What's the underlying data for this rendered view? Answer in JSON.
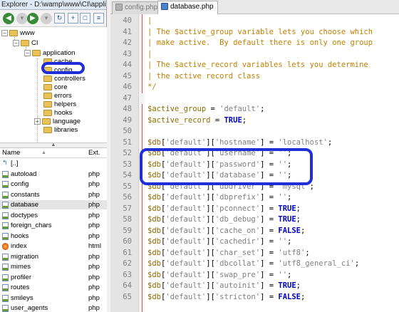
{
  "explorer": {
    "title": "Explorer - D:\\wamp\\www\\CI\\applic...",
    "tree": [
      {
        "label": "www",
        "level": 0,
        "expanded": true
      },
      {
        "label": "CI",
        "level": 1,
        "expanded": true
      },
      {
        "label": "application",
        "level": 2,
        "expanded": true
      },
      {
        "label": "cache",
        "level": 3
      },
      {
        "label": "config",
        "level": 3,
        "selected": true
      },
      {
        "label": "controllers",
        "level": 3
      },
      {
        "label": "core",
        "level": 3
      },
      {
        "label": "errors",
        "level": 3
      },
      {
        "label": "helpers",
        "level": 3
      },
      {
        "label": "hooks",
        "level": 3
      },
      {
        "label": "language",
        "level": 3,
        "expanded": false
      },
      {
        "label": "libraries",
        "level": 3
      }
    ],
    "columns": {
      "name": "Name",
      "ext": "Ext."
    },
    "files": [
      {
        "name": "[..]",
        "ext": "",
        "icon": "up"
      },
      {
        "name": "autoload",
        "ext": "php",
        "icon": "php"
      },
      {
        "name": "config",
        "ext": "php",
        "icon": "php"
      },
      {
        "name": "constants",
        "ext": "php",
        "icon": "php"
      },
      {
        "name": "database",
        "ext": "php",
        "icon": "php",
        "selected": true
      },
      {
        "name": "doctypes",
        "ext": "php",
        "icon": "php"
      },
      {
        "name": "foreign_chars",
        "ext": "php",
        "icon": "php"
      },
      {
        "name": "hooks",
        "ext": "php",
        "icon": "php"
      },
      {
        "name": "index",
        "ext": "html",
        "icon": "html"
      },
      {
        "name": "migration",
        "ext": "php",
        "icon": "php"
      },
      {
        "name": "mimes",
        "ext": "php",
        "icon": "php"
      },
      {
        "name": "profiler",
        "ext": "php",
        "icon": "php"
      },
      {
        "name": "routes",
        "ext": "php",
        "icon": "php"
      },
      {
        "name": "smileys",
        "ext": "php",
        "icon": "php"
      },
      {
        "name": "user_agents",
        "ext": "php",
        "icon": "php"
      }
    ]
  },
  "tabs": [
    {
      "label": "config.php",
      "active": false
    },
    {
      "label": "database.php",
      "active": true
    }
  ],
  "editor": {
    "lines": [
      {
        "n": "40",
        "parts": [
          {
            "t": "|",
            "c": "comment"
          }
        ]
      },
      {
        "n": "41",
        "parts": [
          {
            "t": "| The $active_group variable lets you choose which",
            "c": "comment"
          }
        ]
      },
      {
        "n": "42",
        "parts": [
          {
            "t": "| make active.  By default there is only one group",
            "c": "comment"
          }
        ]
      },
      {
        "n": "43",
        "parts": [
          {
            "t": "|",
            "c": "comment"
          }
        ]
      },
      {
        "n": "44",
        "parts": [
          {
            "t": "| The $active_record variables lets you determine",
            "c": "comment"
          }
        ]
      },
      {
        "n": "45",
        "parts": [
          {
            "t": "| the active record class",
            "c": "comment"
          }
        ]
      },
      {
        "n": "46",
        "parts": [
          {
            "t": "*/",
            "c": "comment"
          }
        ]
      },
      {
        "n": "47",
        "parts": []
      },
      {
        "n": "48",
        "parts": [
          {
            "t": "$active_group",
            "c": "var"
          },
          {
            "t": " = ",
            "c": "punc"
          },
          {
            "t": "'default'",
            "c": "str"
          },
          {
            "t": ";",
            "c": "punc"
          }
        ]
      },
      {
        "n": "49",
        "parts": [
          {
            "t": "$active_record",
            "c": "var"
          },
          {
            "t": " = ",
            "c": "punc"
          },
          {
            "t": "TRUE",
            "c": "kw"
          },
          {
            "t": ";",
            "c": "punc"
          }
        ]
      },
      {
        "n": "50",
        "parts": []
      },
      {
        "n": "51",
        "parts": [
          {
            "t": "$db",
            "c": "var"
          },
          {
            "t": "[",
            "c": "punc"
          },
          {
            "t": "'default'",
            "c": "str"
          },
          {
            "t": "][",
            "c": "punc"
          },
          {
            "t": "'hostname'",
            "c": "str"
          },
          {
            "t": "] = ",
            "c": "punc"
          },
          {
            "t": "'localhost'",
            "c": "str"
          },
          {
            "t": ";",
            "c": "punc"
          }
        ]
      },
      {
        "n": "52",
        "parts": [
          {
            "t": "$db",
            "c": "var"
          },
          {
            "t": "[",
            "c": "punc"
          },
          {
            "t": "'default'",
            "c": "str"
          },
          {
            "t": "][",
            "c": "punc"
          },
          {
            "t": "'username'",
            "c": "str"
          },
          {
            "t": "] = ",
            "c": "punc"
          },
          {
            "t": "''",
            "c": "str"
          },
          {
            "t": ";",
            "c": "punc"
          }
        ]
      },
      {
        "n": "53",
        "parts": [
          {
            "t": "$db",
            "c": "var"
          },
          {
            "t": "[",
            "c": "punc"
          },
          {
            "t": "'default'",
            "c": "str"
          },
          {
            "t": "][",
            "c": "punc"
          },
          {
            "t": "'password'",
            "c": "str"
          },
          {
            "t": "] = ",
            "c": "punc"
          },
          {
            "t": "''",
            "c": "str"
          },
          {
            "t": ";",
            "c": "punc"
          }
        ]
      },
      {
        "n": "54",
        "parts": [
          {
            "t": "$db",
            "c": "var"
          },
          {
            "t": "[",
            "c": "punc"
          },
          {
            "t": "'default'",
            "c": "str"
          },
          {
            "t": "][",
            "c": "punc"
          },
          {
            "t": "'database'",
            "c": "str"
          },
          {
            "t": "] = ",
            "c": "punc"
          },
          {
            "t": "''",
            "c": "str"
          },
          {
            "t": ";",
            "c": "punc"
          }
        ]
      },
      {
        "n": "55",
        "parts": [
          {
            "t": "$db",
            "c": "var"
          },
          {
            "t": "[",
            "c": "punc"
          },
          {
            "t": "'default'",
            "c": "str"
          },
          {
            "t": "][",
            "c": "punc"
          },
          {
            "t": "'dbdriver'",
            "c": "str"
          },
          {
            "t": "] = ",
            "c": "punc"
          },
          {
            "t": "'mysql'",
            "c": "str"
          },
          {
            "t": ";",
            "c": "punc"
          }
        ]
      },
      {
        "n": "56",
        "parts": [
          {
            "t": "$db",
            "c": "var"
          },
          {
            "t": "[",
            "c": "punc"
          },
          {
            "t": "'default'",
            "c": "str"
          },
          {
            "t": "][",
            "c": "punc"
          },
          {
            "t": "'dbprefix'",
            "c": "str"
          },
          {
            "t": "] = ",
            "c": "punc"
          },
          {
            "t": "''",
            "c": "str"
          },
          {
            "t": ";",
            "c": "punc"
          }
        ]
      },
      {
        "n": "57",
        "parts": [
          {
            "t": "$db",
            "c": "var"
          },
          {
            "t": "[",
            "c": "punc"
          },
          {
            "t": "'default'",
            "c": "str"
          },
          {
            "t": "][",
            "c": "punc"
          },
          {
            "t": "'pconnect'",
            "c": "str"
          },
          {
            "t": "] = ",
            "c": "punc"
          },
          {
            "t": "TRUE",
            "c": "kw"
          },
          {
            "t": ";",
            "c": "punc"
          }
        ]
      },
      {
        "n": "58",
        "parts": [
          {
            "t": "$db",
            "c": "var"
          },
          {
            "t": "[",
            "c": "punc"
          },
          {
            "t": "'default'",
            "c": "str"
          },
          {
            "t": "][",
            "c": "punc"
          },
          {
            "t": "'db_debug'",
            "c": "str"
          },
          {
            "t": "] = ",
            "c": "punc"
          },
          {
            "t": "TRUE",
            "c": "kw"
          },
          {
            "t": ";",
            "c": "punc"
          }
        ]
      },
      {
        "n": "59",
        "parts": [
          {
            "t": "$db",
            "c": "var"
          },
          {
            "t": "[",
            "c": "punc"
          },
          {
            "t": "'default'",
            "c": "str"
          },
          {
            "t": "][",
            "c": "punc"
          },
          {
            "t": "'cache_on'",
            "c": "str"
          },
          {
            "t": "] = ",
            "c": "punc"
          },
          {
            "t": "FALSE",
            "c": "kw"
          },
          {
            "t": ";",
            "c": "punc"
          }
        ]
      },
      {
        "n": "60",
        "parts": [
          {
            "t": "$db",
            "c": "var"
          },
          {
            "t": "[",
            "c": "punc"
          },
          {
            "t": "'default'",
            "c": "str"
          },
          {
            "t": "][",
            "c": "punc"
          },
          {
            "t": "'cachedir'",
            "c": "str"
          },
          {
            "t": "] = ",
            "c": "punc"
          },
          {
            "t": "''",
            "c": "str"
          },
          {
            "t": ";",
            "c": "punc"
          }
        ]
      },
      {
        "n": "61",
        "parts": [
          {
            "t": "$db",
            "c": "var"
          },
          {
            "t": "[",
            "c": "punc"
          },
          {
            "t": "'default'",
            "c": "str"
          },
          {
            "t": "][",
            "c": "punc"
          },
          {
            "t": "'char_set'",
            "c": "str"
          },
          {
            "t": "] = ",
            "c": "punc"
          },
          {
            "t": "'utf8'",
            "c": "str"
          },
          {
            "t": ";",
            "c": "punc"
          }
        ]
      },
      {
        "n": "62",
        "parts": [
          {
            "t": "$db",
            "c": "var"
          },
          {
            "t": "[",
            "c": "punc"
          },
          {
            "t": "'default'",
            "c": "str"
          },
          {
            "t": "][",
            "c": "punc"
          },
          {
            "t": "'dbcollat'",
            "c": "str"
          },
          {
            "t": "] = ",
            "c": "punc"
          },
          {
            "t": "'utf8_general_ci'",
            "c": "str"
          },
          {
            "t": ";",
            "c": "punc"
          }
        ]
      },
      {
        "n": "63",
        "parts": [
          {
            "t": "$db",
            "c": "var"
          },
          {
            "t": "[",
            "c": "punc"
          },
          {
            "t": "'default'",
            "c": "str"
          },
          {
            "t": "][",
            "c": "punc"
          },
          {
            "t": "'swap_pre'",
            "c": "str"
          },
          {
            "t": "] = ",
            "c": "punc"
          },
          {
            "t": "''",
            "c": "str"
          },
          {
            "t": ";",
            "c": "punc"
          }
        ]
      },
      {
        "n": "64",
        "parts": [
          {
            "t": "$db",
            "c": "var"
          },
          {
            "t": "[",
            "c": "punc"
          },
          {
            "t": "'default'",
            "c": "str"
          },
          {
            "t": "][",
            "c": "punc"
          },
          {
            "t": "'autoinit'",
            "c": "str"
          },
          {
            "t": "] = ",
            "c": "punc"
          },
          {
            "t": "TRUE",
            "c": "kw"
          },
          {
            "t": ";",
            "c": "punc"
          }
        ]
      },
      {
        "n": "65",
        "parts": [
          {
            "t": "$db",
            "c": "var"
          },
          {
            "t": "[",
            "c": "punc"
          },
          {
            "t": "'default'",
            "c": "str"
          },
          {
            "t": "][",
            "c": "punc"
          },
          {
            "t": "'stricton'",
            "c": "str"
          },
          {
            "t": "] = ",
            "c": "punc"
          },
          {
            "t": "FALSE",
            "c": "kw"
          },
          {
            "t": ";",
            "c": "punc"
          }
        ]
      }
    ]
  },
  "colors": {
    "comment": "#c08000",
    "variable": "#8f6b00",
    "string": "#808080",
    "keyword": "#0000c0",
    "highlight": "#1f2ed8"
  }
}
